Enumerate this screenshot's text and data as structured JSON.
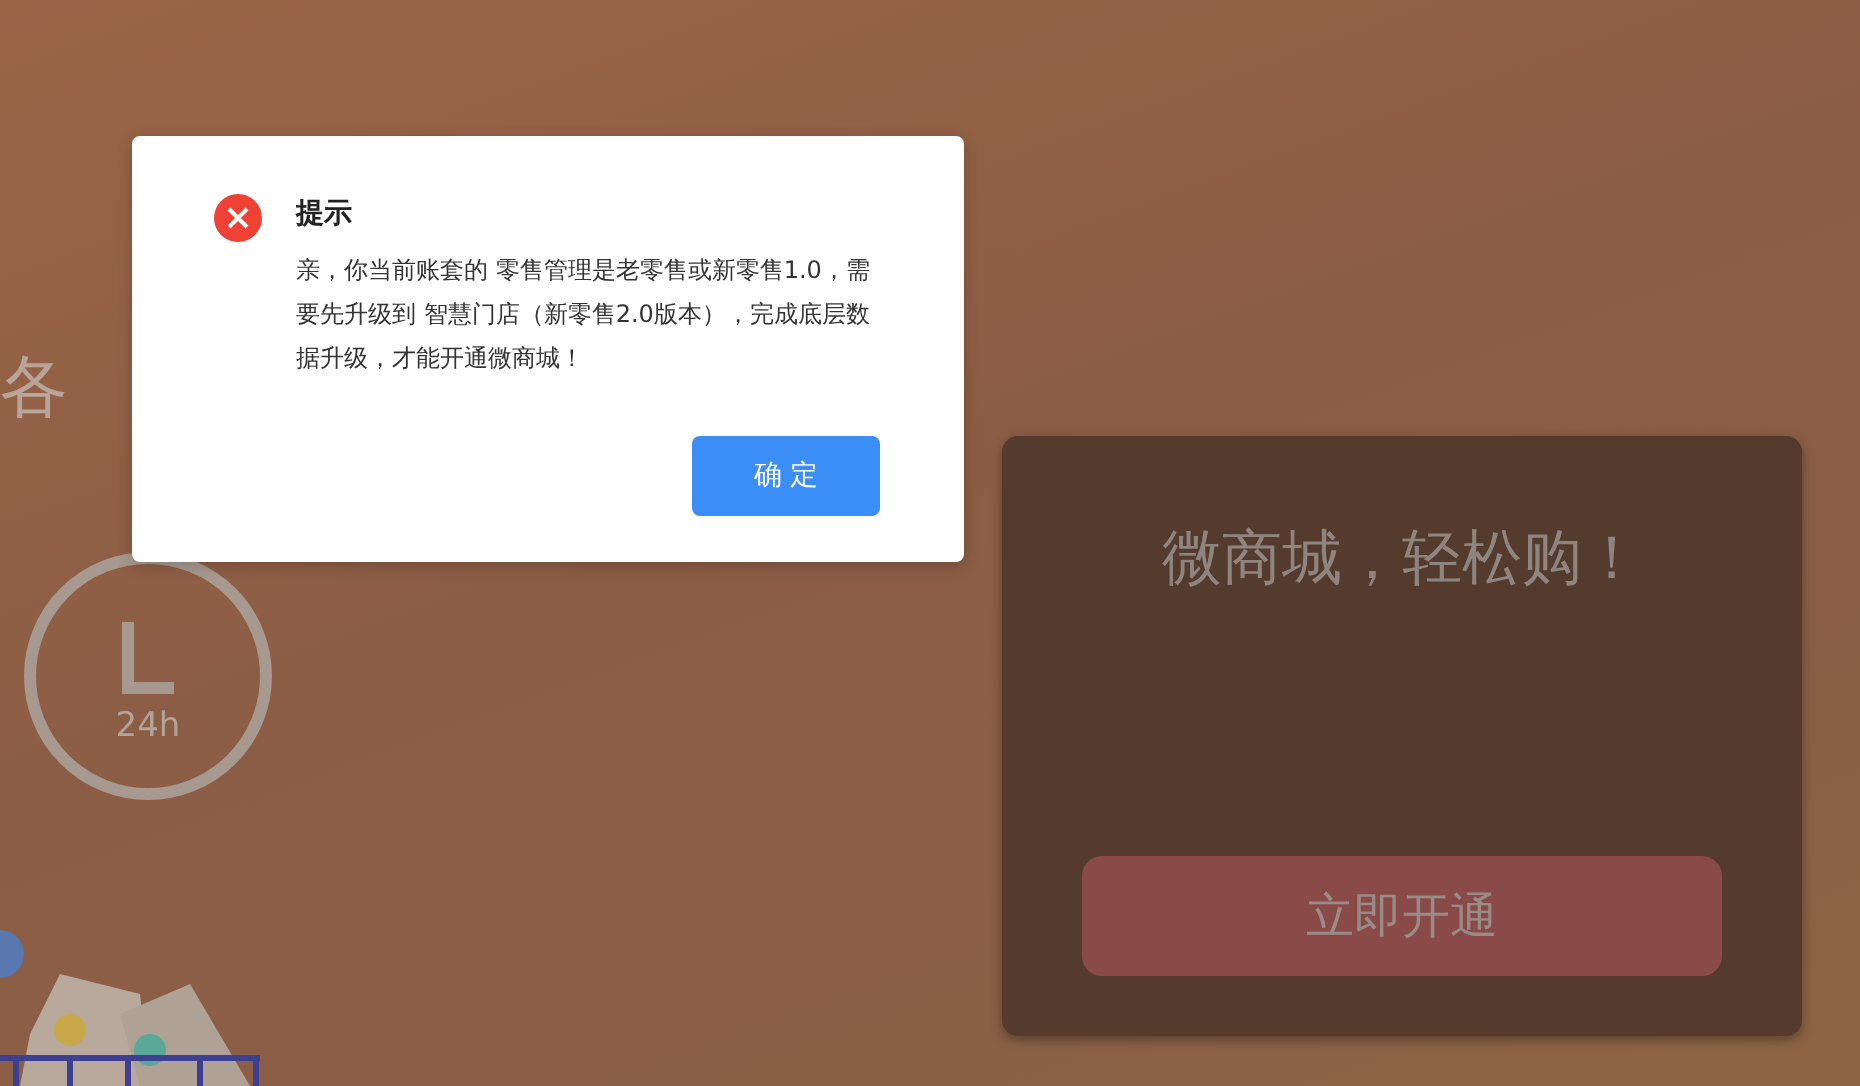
{
  "background": {
    "headline_fragment": "各",
    "clock_label": "24h"
  },
  "promo_card": {
    "title": "微商城，轻松购！",
    "button": "立即开通"
  },
  "dialog": {
    "title": "提示",
    "message": "亲，你当前账套的 零售管理是老零售或新零售1.0，需要先升级到 智慧门店（新零售2.0版本），完成底层数据升级，才能开通微商城！",
    "button": "确 定"
  }
}
